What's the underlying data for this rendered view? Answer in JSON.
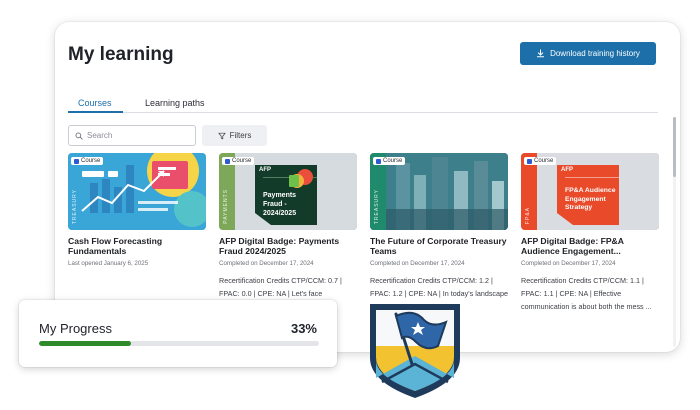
{
  "panel": {
    "title": "My learning",
    "download_button": "Download training history"
  },
  "tabs": [
    {
      "label": "Courses",
      "active": true
    },
    {
      "label": "Learning paths",
      "active": false
    }
  ],
  "search": {
    "placeholder": "Search"
  },
  "filters_label": "Filters",
  "cards": [
    {
      "badge": "Course",
      "title": "Cash Flow Forecasting Fundamentals",
      "date": "Last opened January 6, 2025",
      "description": "",
      "thumb_label": "TREASURY"
    },
    {
      "badge": "Course",
      "title": "AFP Digital Badge: Payments Fraud 2024/2025",
      "date": "Completed on December 17, 2024",
      "description": "Recertification Credits CTP/CCM: 0.7 | FPAC: 0.0 | CPE: NA | Let's face",
      "thumb_label": "PAYMENTS",
      "thumb_brand": "AFP",
      "thumb_heading": "Payments Fraud - 2024/2025"
    },
    {
      "badge": "Course",
      "title": "The Future of Corporate Treasury Teams",
      "date": "Completed on December 17, 2024",
      "description": "Recertification Credits CTP/CCM: 1.2 | FPAC: 1.2 | CPE: NA | In today's landscape",
      "thumb_label": "TREASURY"
    },
    {
      "badge": "Course",
      "title": "AFP Digital Badge: FP&A Audience Engagement...",
      "date": "Completed on December 17, 2024",
      "description": "Recertification Credits CTP/CCM: 1.1 | FPAC: 1.1 | CPE: NA | Effective communication is about both the mess ...",
      "thumb_label": "FP&A",
      "thumb_brand": "AFP",
      "thumb_heading": "FP&A Audience Engagement Strategy"
    }
  ],
  "progress": {
    "label": "My Progress",
    "value_text": "33%",
    "fraction": 0.33
  },
  "colors": {
    "accent": "#1c6fa8",
    "progress_fill": "#2f8b2a",
    "badge_yellow": "#f2c230",
    "badge_navy": "#1f3b5c"
  }
}
